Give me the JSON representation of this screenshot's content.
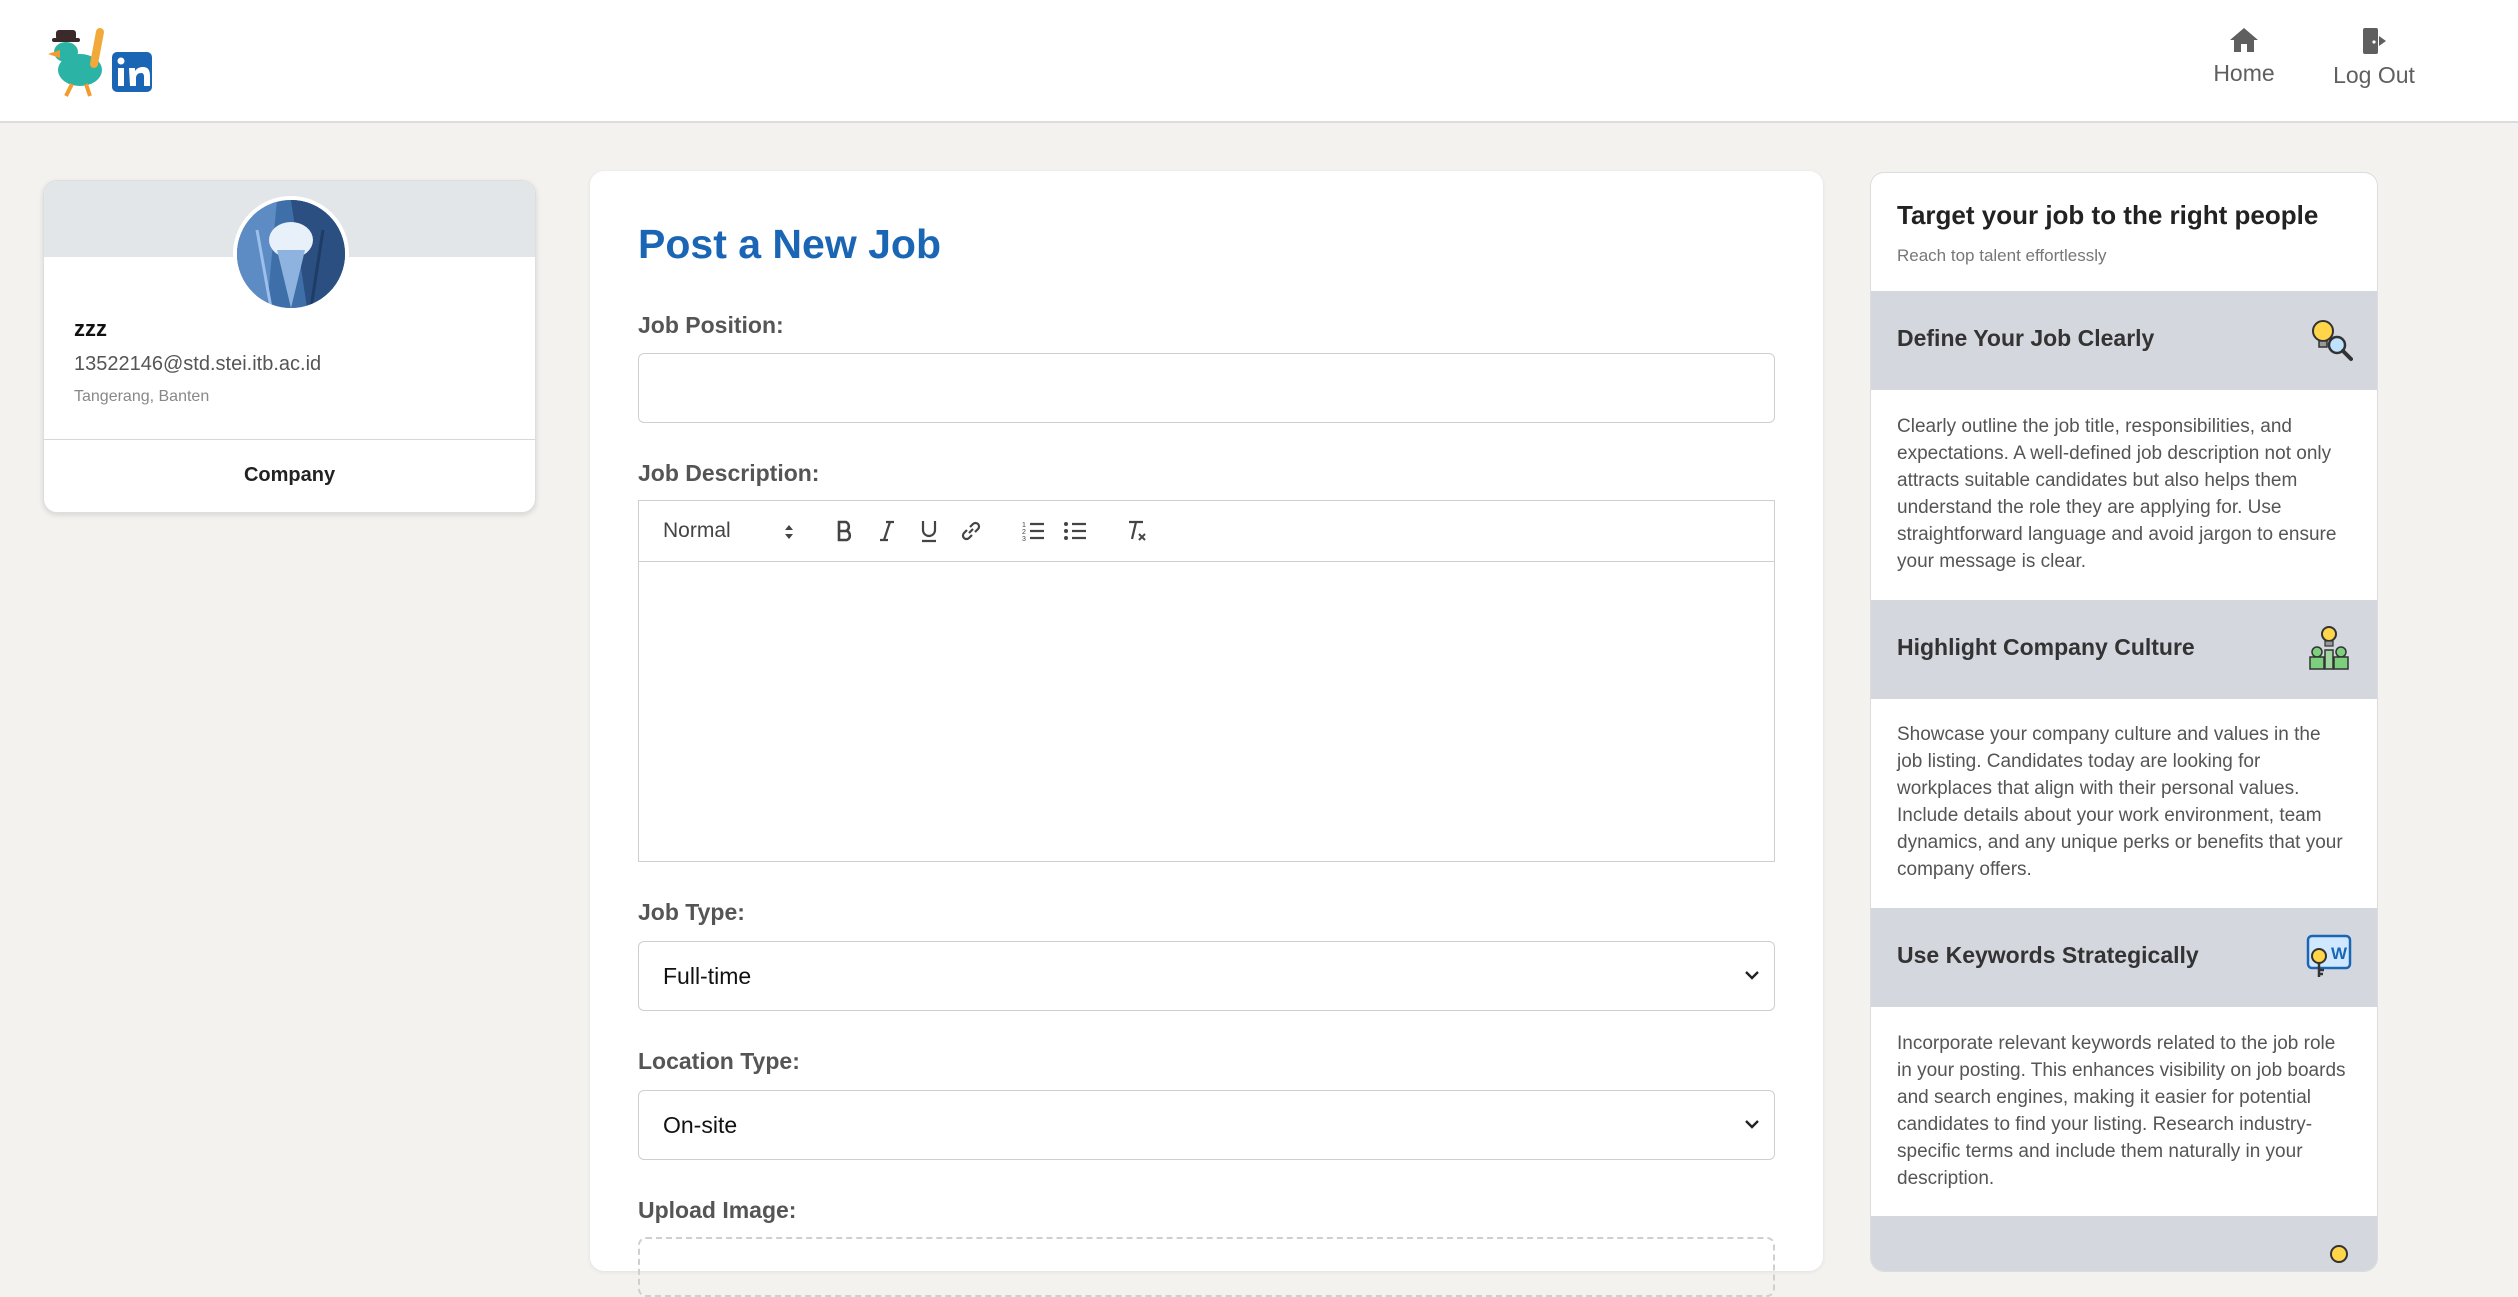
{
  "nav": {
    "home_label": "Home",
    "logout_label": "Log Out"
  },
  "profile": {
    "name": "zzz",
    "email": "13522146@std.stei.itb.ac.id",
    "location": "Tangerang, Banten",
    "role": "Company"
  },
  "form": {
    "title": "Post a New Job",
    "job_position_label": "Job Position:",
    "job_position_value": "",
    "job_description_label": "Job Description:",
    "editor_format": "Normal",
    "job_type_label": "Job Type:",
    "job_type_value": "Full-time",
    "location_type_label": "Location Type:",
    "location_type_value": "On-site",
    "upload_label": "Upload Image:"
  },
  "tips": {
    "title": "Target your job to the right people",
    "subtitle": "Reach top talent effortlessly",
    "items": [
      {
        "heading": "Define Your Job Clearly",
        "icon": "lightbulb-magnifier-icon",
        "body": "Clearly outline the job title, responsibilities, and expectations. A well-defined job description not only attracts suitable candidates but also helps them understand the role they are applying for. Use straightforward language and avoid jargon to ensure your message is clear."
      },
      {
        "heading": "Highlight Company Culture",
        "icon": "team-idea-icon",
        "body": "Showcase your company culture and values in the job listing. Candidates today are looking for workplaces that align with their personal values. Include details about your work environment, team dynamics, and any unique perks or benefits that your company offers."
      },
      {
        "heading": "Use Keywords Strategically",
        "icon": "keyword-key-icon",
        "body": "Incorporate relevant keywords related to the job role in your posting. This enhances visibility on job boards and search engines, making it easier for potential candidates to find your listing. Research industry-specific terms and include them naturally in your description."
      }
    ]
  },
  "colors": {
    "accent": "#1a66b5",
    "page_bg": "#f3f2ef",
    "tip_header_bg": "#d4d7de"
  }
}
